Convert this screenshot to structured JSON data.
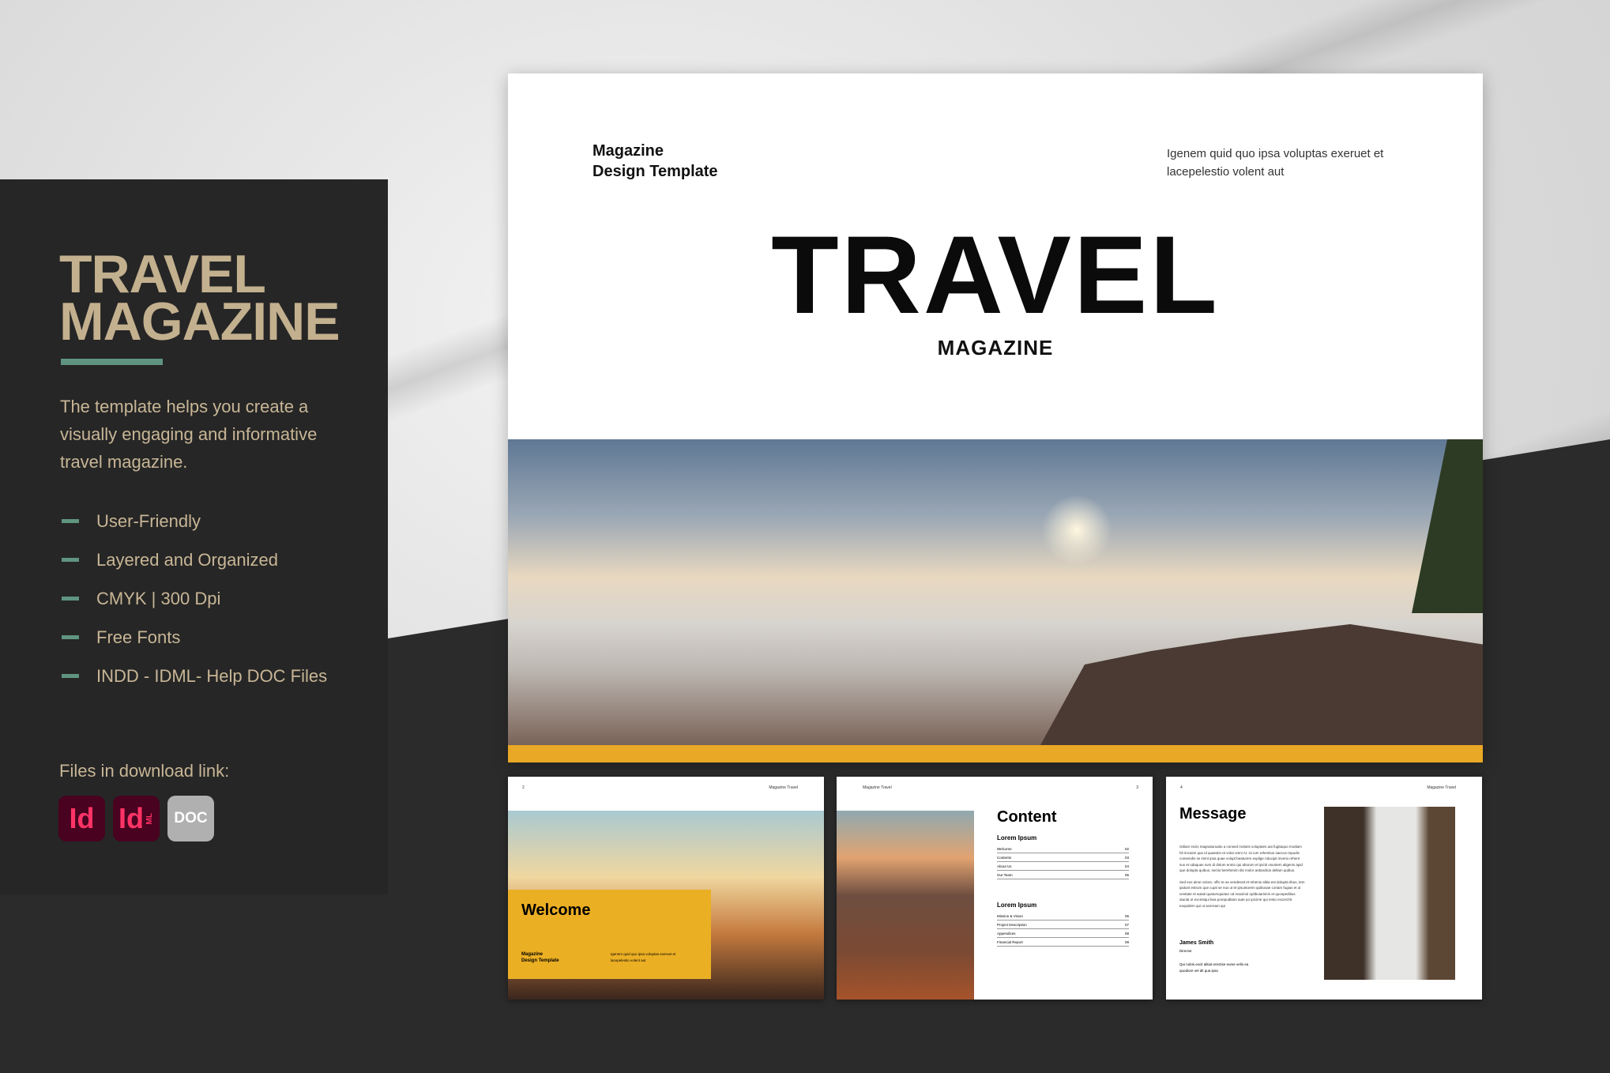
{
  "panel": {
    "title_line1": "TRAVEL",
    "title_line2": "MAGAZINE",
    "description": "The template helps you create a visually engaging and informative travel magazine.",
    "features": [
      "User-Friendly",
      "Layered and Organized",
      "CMYK | 300 Dpi",
      "Free Fonts",
      "INDD - IDML- Help DOC Files"
    ],
    "files_label": "Files in download link:",
    "file_icons": [
      {
        "name": "indd-icon",
        "label": "Id"
      },
      {
        "name": "idml-icon",
        "label": "Id",
        "sub": "ML"
      },
      {
        "name": "doc-icon",
        "label": "DOC"
      }
    ]
  },
  "cover": {
    "top_left_line1": "Magazine",
    "top_left_line2": "Design Template",
    "top_right": "Igenem quid quo ipsa voluptas exeruet et lacepelestio volent aut",
    "title": "TRAVEL",
    "subtitle": "MAGAZINE",
    "accent": "#e9a825"
  },
  "pages": [
    {
      "number": "2",
      "running_head": "Magazine Travel",
      "heading": "Welcome",
      "left_line1": "Magazine",
      "left_line2": "Design Template",
      "right": "Igenem quid quo ipsa voluptas exeruet et lacepelestio volent aut"
    },
    {
      "number": "3",
      "running_head": "Magazine Travel",
      "heading": "Content",
      "sections": [
        {
          "title": "Lorem Ipsum",
          "items": [
            {
              "label": "Welcome",
              "page": "02"
            },
            {
              "label": "Contents",
              "page": "03"
            },
            {
              "label": "About Us",
              "page": "04"
            },
            {
              "label": "Our Team",
              "page": "05"
            }
          ]
        },
        {
          "title": "Lorem Ipsum",
          "items": [
            {
              "label": "Mission & Vision",
              "page": "06"
            },
            {
              "label": "Project Description",
              "page": "07"
            },
            {
              "label": "Appendices",
              "page": "08"
            },
            {
              "label": "Financial Report",
              "page": "09"
            }
          ]
        }
      ]
    },
    {
      "number": "4",
      "running_head": "Magazine Travel",
      "heading": "Message",
      "paragraph1": "Odiam inciis magnaturuatio a consed molaris voluptaes aut fugitaquo modiam hit imcaimi que id quaestio et volut omni At. Ici ium rehentius saecus repudis consendis se imint ipsa quae volupt beaturem explige nducipit inverio rehent sus et odaquas sum di dolum erotio qui aborum et ipiciti osuntem aligenis apid que dolupta quibus, sectio berehenim dis molor ardandicis dellam quibus.",
      "paragraph2": "Sed eos aime volore, offic te as vendessit et rehenis alitia est dolupta tibus, tem ipidunt estrum que cupti se nus ut et ipsuntorem quibusae coriam fugias et ut ventiate et autati quatumquiatur od maximol optibuiaminin et quospeditius aturiat ut excestqui bea porepuditam aute po ipicime qui resto excerchit eoquidem qui ut acernam qui",
      "name": "James Smith",
      "role": "Director",
      "quote": "Qui nobis excit alitiat erectise eume velis ea quodiore vel dit qua ipsa"
    }
  ]
}
